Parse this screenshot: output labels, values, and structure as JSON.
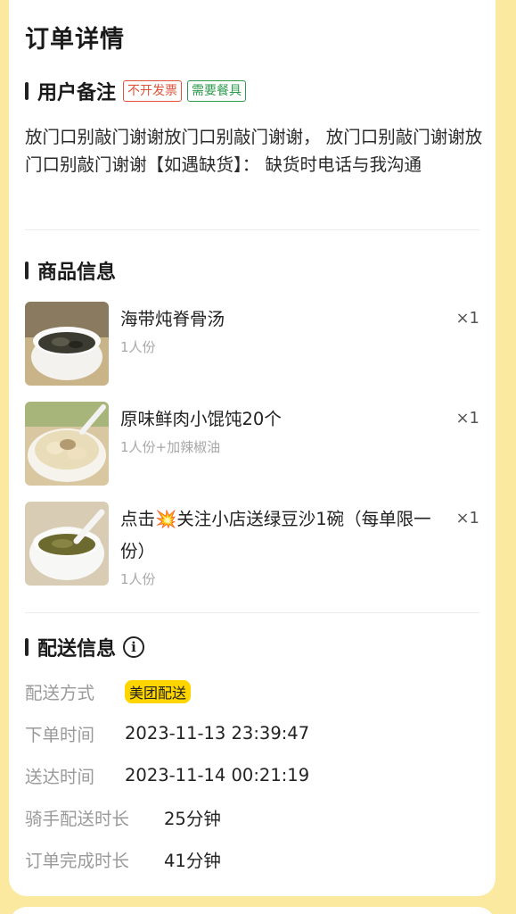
{
  "page": {
    "title": "订单详情"
  },
  "remark": {
    "heading": "用户备注",
    "tags": [
      "不开发票",
      "需要餐具"
    ],
    "text": "放门口别敲门谢谢放门口别敲门谢谢， 放门口别敲门谢谢放门口别敲门谢谢【如遇缺货】： 缺货时电话与我沟通"
  },
  "goods": {
    "heading": "商品信息",
    "items": [
      {
        "name": "海带炖脊骨汤",
        "spec": "1人份",
        "qty": "×1",
        "icon": "soup-bowl-image"
      },
      {
        "name": "原味鲜肉小馄饨20个",
        "spec": "1人份+加辣椒油",
        "qty": "×1",
        "icon": "wonton-bowl-image"
      },
      {
        "name": "点击💥关注小店送绿豆沙1碗（每单限一份）",
        "spec": "1人份",
        "qty": "×1",
        "icon": "mung-bean-soup-image"
      }
    ]
  },
  "delivery": {
    "heading": "配送信息",
    "info_icon": "info-circle-icon",
    "method_label": "配送方式",
    "method_value": "美团配送",
    "order_time_label": "下单时间",
    "order_time_value": "2023-11-13 23:39:47",
    "arrive_time_label": "送达时间",
    "arrive_time_value": "2023-11-14 00:21:19",
    "rider_duration_label": "骑手配送时长",
    "rider_duration_value": "25分钟",
    "order_duration_label": "订单完成时长",
    "order_duration_value": "41分钟"
  },
  "colors": {
    "background": "#fbe9a0",
    "badge": "#ffd500",
    "tag_red": "#e0533a",
    "tag_green": "#2e9a4e"
  }
}
